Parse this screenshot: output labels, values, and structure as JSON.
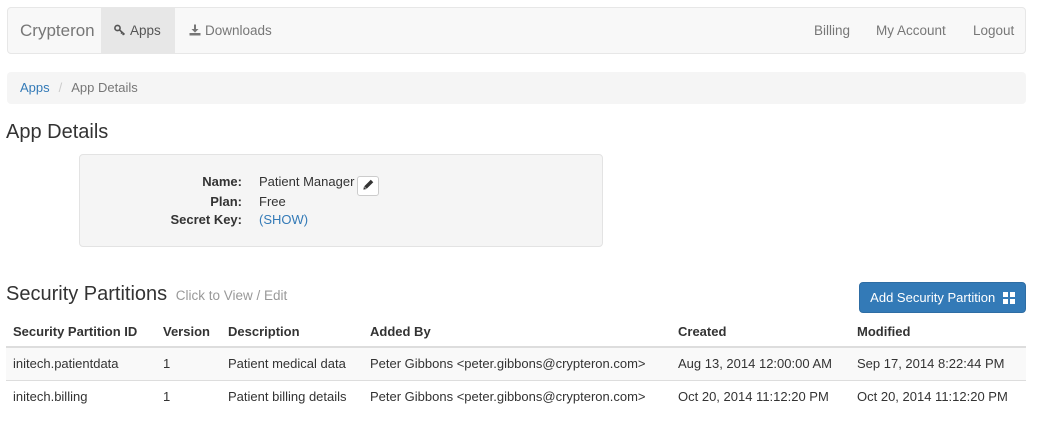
{
  "navbar": {
    "brand": "Crypteron",
    "left_items": [
      {
        "label": "Apps",
        "icon": "key-icon",
        "active": true
      },
      {
        "label": "Downloads",
        "icon": "download-icon",
        "active": false
      }
    ],
    "right_items": [
      {
        "label": "Billing"
      },
      {
        "label": "My Account"
      },
      {
        "label": "Logout"
      }
    ]
  },
  "breadcrumb": {
    "items": [
      "Apps",
      "App Details"
    ],
    "separator": "/"
  },
  "page_title": "App Details",
  "details": {
    "name_label": "Name:",
    "name_value": "Patient Manager",
    "plan_label": "Plan:",
    "plan_value": "Free",
    "secret_label": "Secret Key:",
    "secret_value": "(SHOW)"
  },
  "partitions": {
    "title": "Security Partitions",
    "hint": "Click to View / Edit",
    "add_button_label": "Add Security Partition",
    "columns": [
      "Security Partition ID",
      "Version",
      "Description",
      "Added By",
      "Created",
      "Modified"
    ],
    "rows": [
      [
        "initech.patientdata",
        "1",
        "Patient medical data",
        "Peter Gibbons <peter.gibbons@crypteron.com>",
        "Aug 13, 2014 12:00:00 AM",
        "Sep 17, 2014 8:22:44 PM"
      ],
      [
        "initech.billing",
        "1",
        "Patient billing details",
        "Peter Gibbons <peter.gibbons@crypteron.com>",
        "Oct 20, 2014 11:12:20 PM",
        "Oct 20, 2014 11:12:20 PM"
      ]
    ]
  },
  "colors": {
    "link": "#337ab7",
    "primary_button": "#337ab7",
    "navbar_bg": "#f8f8f8",
    "active_nav_bg": "#e7e7e7"
  }
}
